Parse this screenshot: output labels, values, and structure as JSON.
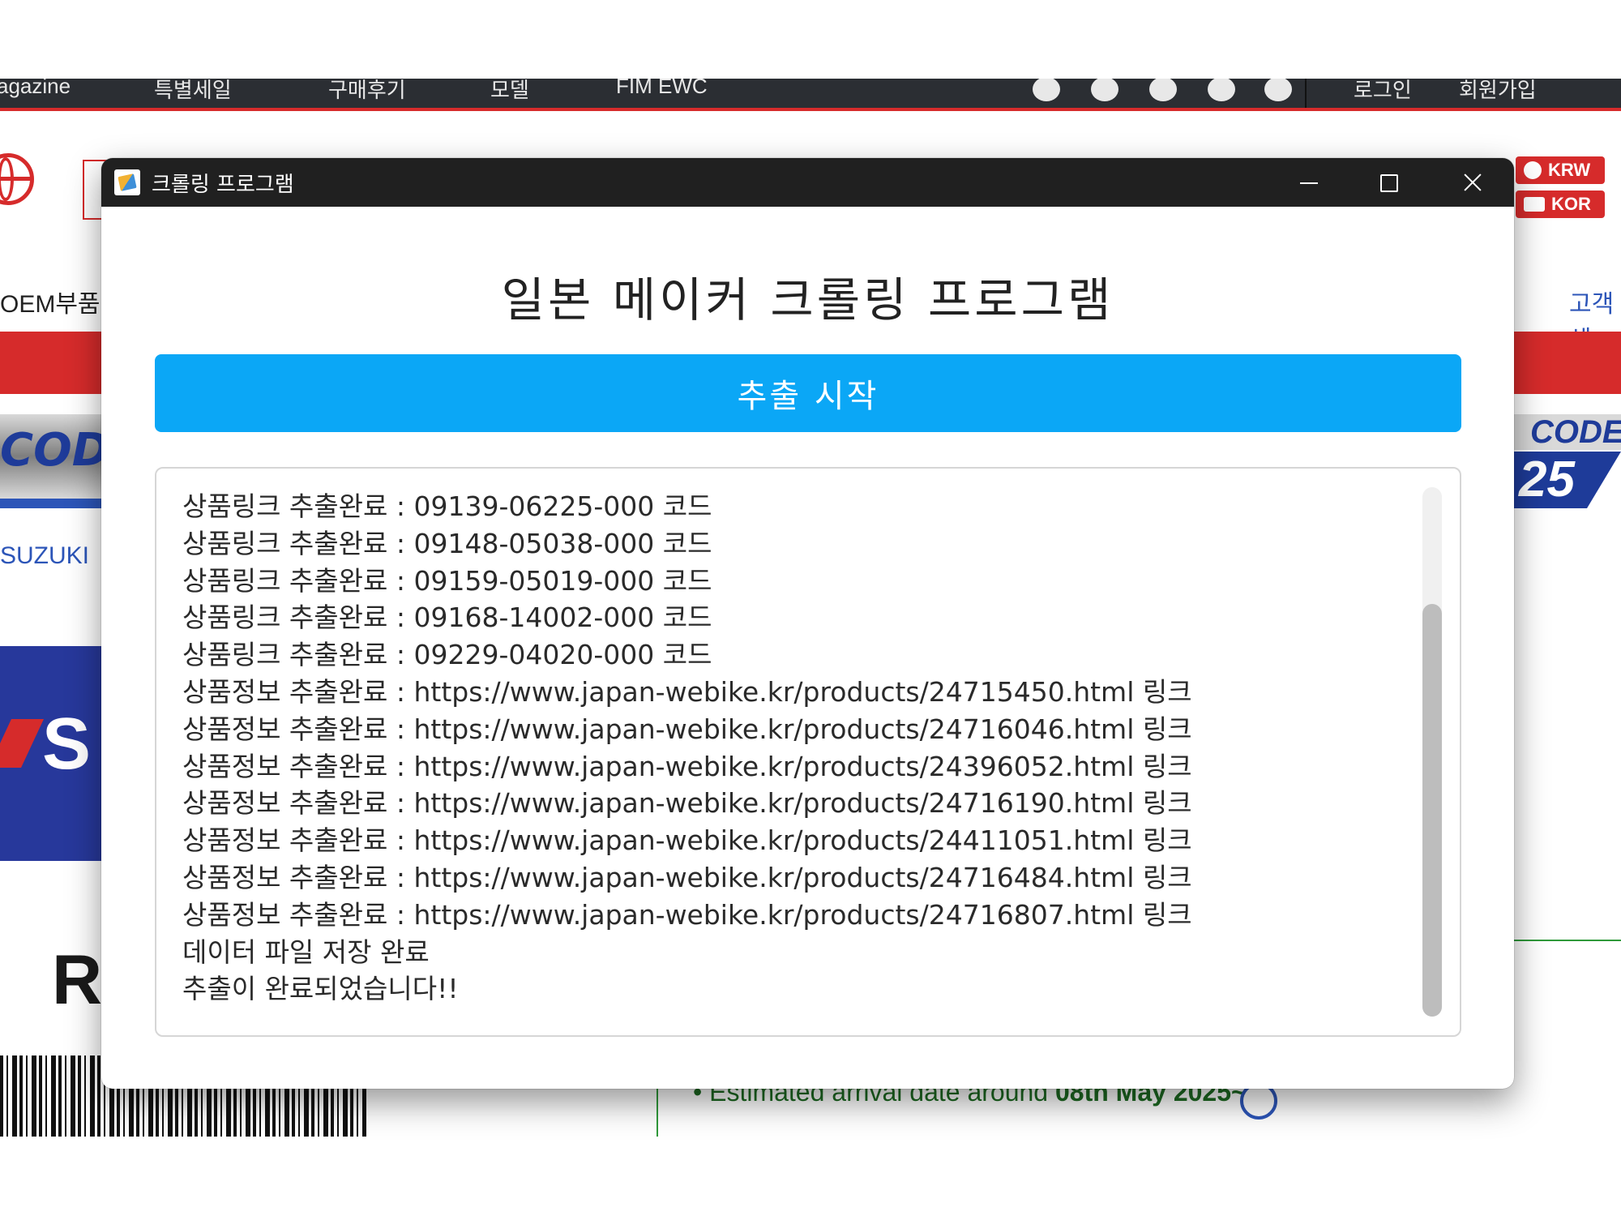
{
  "background_page": {
    "topbar": {
      "items": [
        "agazine",
        "특별세일",
        "구매후기",
        "모델",
        "FIM EWC"
      ],
      "right_items": [
        "로그인",
        "회원가입"
      ]
    },
    "currency_label": "KRW",
    "country_label": "KOR",
    "oem_label": "OEM부품",
    "support_label": "고객센",
    "suzuki_link": "SUZUKI",
    "banner_left": "CODE",
    "banner_right_top": "CODE",
    "banner_right_bottom": "25",
    "suzuki_letter": "S",
    "model_text": "R",
    "arrival_text": "• Estimated arrival date around",
    "arrival_date": "08th May 2025~"
  },
  "window": {
    "title": "크롤링 프로그램",
    "heading": "일본 메이커 크롤링 프로그램",
    "start_button": "추출 시작",
    "log_lines": [
      "상품링크 추출완료 : 09139-06225-000 코드",
      "상품링크 추출완료 : 09148-05038-000 코드",
      "상품링크 추출완료 : 09159-05019-000 코드",
      "상품링크 추출완료 : 09168-14002-000 코드",
      "상품링크 추출완료 : 09229-04020-000 코드",
      "상품정보 추출완료 : https://www.japan-webike.kr/products/24715450.html 링크",
      "상품정보 추출완료 : https://www.japan-webike.kr/products/24716046.html 링크",
      "상품정보 추출완료 : https://www.japan-webike.kr/products/24396052.html 링크",
      "상품정보 추출완료 : https://www.japan-webike.kr/products/24716190.html 링크",
      "상품정보 추출완료 : https://www.japan-webike.kr/products/24411051.html 링크",
      "상품정보 추출완료 : https://www.japan-webike.kr/products/24716484.html 링크",
      "상품정보 추출완료 : https://www.japan-webike.kr/products/24716807.html 링크",
      "데이터 파일 저장 완료",
      "추출이 완료되었습니다!!"
    ]
  },
  "colors": {
    "accent_button": "#0ba7f6",
    "titlebar": "#202020",
    "site_red": "#d62b2b",
    "site_blue": "#2c55b8"
  },
  "icons": [
    "app-icon",
    "minimize-icon",
    "maximize-icon",
    "close-icon",
    "globe-icon",
    "currency-icon",
    "truck-icon",
    "info-icon"
  ]
}
